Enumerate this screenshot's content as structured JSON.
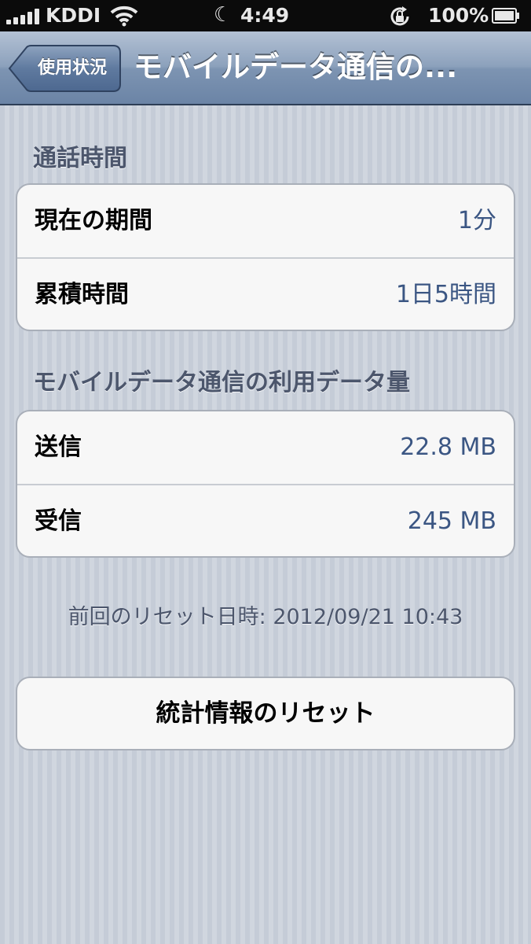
{
  "status_bar": {
    "carrier": "KDDI",
    "time": "4:49",
    "battery_pct": "100%",
    "icons": [
      "signal-icon",
      "wifi-icon",
      "moon-icon",
      "rotation-lock-icon",
      "battery-icon"
    ]
  },
  "nav": {
    "back_label": "使用状況",
    "title": "モバイルデータ通信の..."
  },
  "call_time": {
    "header": "通話時間",
    "rows": [
      {
        "label": "現在の期間",
        "value": "1分"
      },
      {
        "label": "累積時間",
        "value": "1日5時間"
      }
    ]
  },
  "cellular_data": {
    "header": "モバイルデータ通信の利用データ量",
    "rows": [
      {
        "label": "送信",
        "value": "22.8 MB"
      },
      {
        "label": "受信",
        "value": "245 MB"
      }
    ]
  },
  "last_reset": "前回のリセット日時: 2012/09/21 10:43",
  "reset_button_label": "統計情報のリセット",
  "colors": {
    "value_text": "#3b5683",
    "header_text": "#4c566c",
    "nav_bar": "#7d94b2"
  }
}
